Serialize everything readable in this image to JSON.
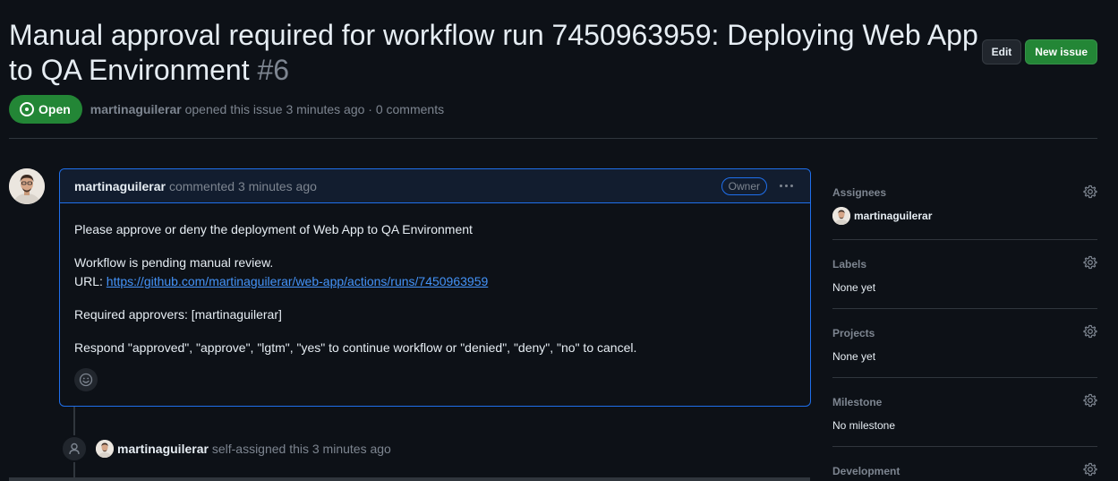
{
  "issue": {
    "title": "Manual approval required for workflow run 7450963959: Deploying Web App to QA Environment",
    "number": "#6",
    "state": "Open",
    "author": "martinaguilerar",
    "meta_rest": "opened this issue 3 minutes ago · 0 comments"
  },
  "header": {
    "edit_label": "Edit",
    "new_issue_label": "New issue"
  },
  "comment": {
    "author": "martinaguilerar",
    "action": "commented 3 minutes ago",
    "badge": "Owner",
    "line1": "Please approve or deny the deployment of Web App to QA Environment",
    "line2": "Workflow is pending manual review.",
    "url_prefix": "URL: ",
    "url": "https://github.com/martinaguilerar/web-app/actions/runs/7450963959",
    "line3": "Required approvers: [martinaguilerar]",
    "line4": "Respond \"approved\", \"approve\", \"lgtm\", \"yes\" to continue workflow or \"denied\", \"deny\", \"no\" to cancel."
  },
  "timeline": {
    "author": "martinaguilerar",
    "text": "self-assigned this 3 minutes ago"
  },
  "sidebar": {
    "assignees": {
      "label": "Assignees",
      "value": "martinaguilerar"
    },
    "labels": {
      "label": "Labels",
      "value": "None yet"
    },
    "projects": {
      "label": "Projects",
      "value": "None yet"
    },
    "milestone": {
      "label": "Milestone",
      "value": "No milestone"
    },
    "development": {
      "label": "Development"
    }
  },
  "colors": {
    "open_green": "#238636",
    "link_blue": "#4493f8",
    "accent_border": "#1f6feb",
    "background": "#0d1117"
  }
}
